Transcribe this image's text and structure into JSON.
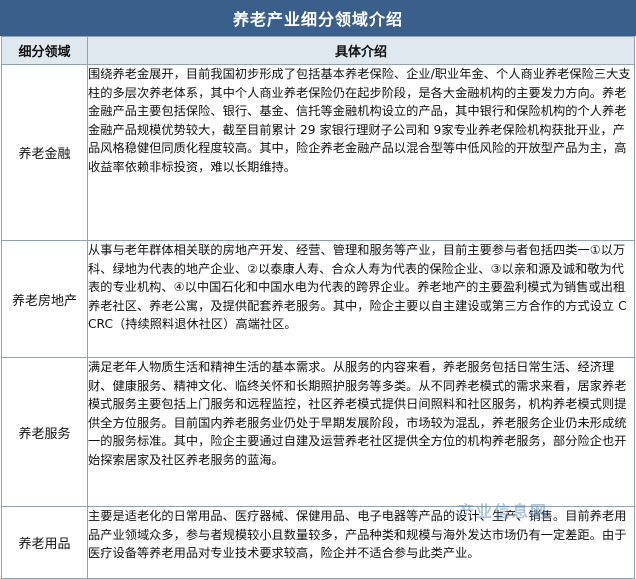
{
  "title": "养老产业细分领域介绍",
  "header": {
    "col1": "细分领域",
    "col2": "具体介绍"
  },
  "rows": [
    {
      "label": "养老金融",
      "text": "围绕养老金展开，目前我国初步形成了包括基本养老保险、企业/职业年金、个人商业养老保险三大支柱的多层次养老体系，其中个人商业养老保险仍在起步阶段，是各大金融机构的主要发力方向。养老金融产品主要包括保险、银行、基金、信托等金融机构设立的产品，其中银行和保险机构的个人养老金融产品规模优势较大，截至目前累计 29 家银行理财子公司和 9家专业养老保险机构获批开业，产品风格稳健但同质化程度较高。其中，险企养老金融产品以混合型等中低风险的开放型产品为主，高收益率依赖非标投资，难以长期维持。"
    },
    {
      "label": "养老房地产",
      "text": "从事与老年群体相关联的房地产开发、经营、管理和服务等产业，目前主要参与者包括四类一①以万科、绿地为代表的地产企业、②以泰康人寿、合众人寿为代表的保险企业、③以亲和源及诚和敬为代表的专业机构、④以中国石化和中国水电为代表的跨界企业。养老地产的主要盈利模式为销售或出租养老社区、养老公寓，及提供配套养老服务。其中，险企主要以自主建设或第三方合作的方式设立 CCRC（持续照料退休社区）高端社区。"
    },
    {
      "label": "养老服务",
      "text": "满足老年人物质生活和精神生活的基本需求。从服务的内容来看，养老服务包括日常生活、经济理财、健康服务、精神文化、临终关怀和长期照护服务等多类。从不同养老模式的需求来看，居家养老模式服务主要包括上门服务和远程监控，社区养老模式提供日间照料和社区服务，机构养老模式则提供全方位服务。目前国内养老服务业仍处于早期发展阶段，市场较为混乱，养老服务企业仍未形成统一的服务标准。其中，险企主要通过自建及运营养老社区提供全方位的机构养老服务，部分险企也开始探索居家及社区养老服务的蓝海。"
    },
    {
      "label": "养老用品",
      "text": "主要是适老化的日常用品、医疗器械、保健用品、电子电器等产品的设计、生产、销售。目前养老用品产业领域众多，参与者规模较小且数量较多，产品种类和规模与海外发达市场仍有一定差距。由于医疗设备等养老用品对专业技术要求较高，险企并不适合参与此类产业。"
    }
  ],
  "watermark": "产业信息网"
}
